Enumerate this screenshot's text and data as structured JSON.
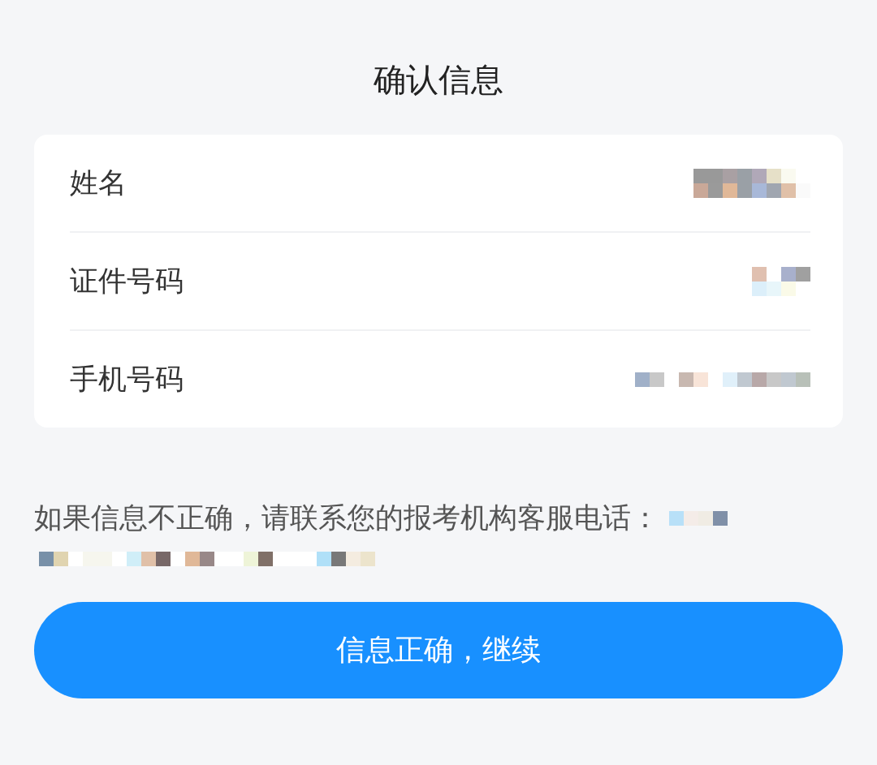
{
  "title": "确认信息",
  "fields": [
    {
      "label": "姓名"
    },
    {
      "label": "证件号码"
    },
    {
      "label": "手机号码"
    }
  ],
  "notice": "如果信息不正确，请联系您的报考机构客服电话：",
  "button": "信息正确，继续"
}
